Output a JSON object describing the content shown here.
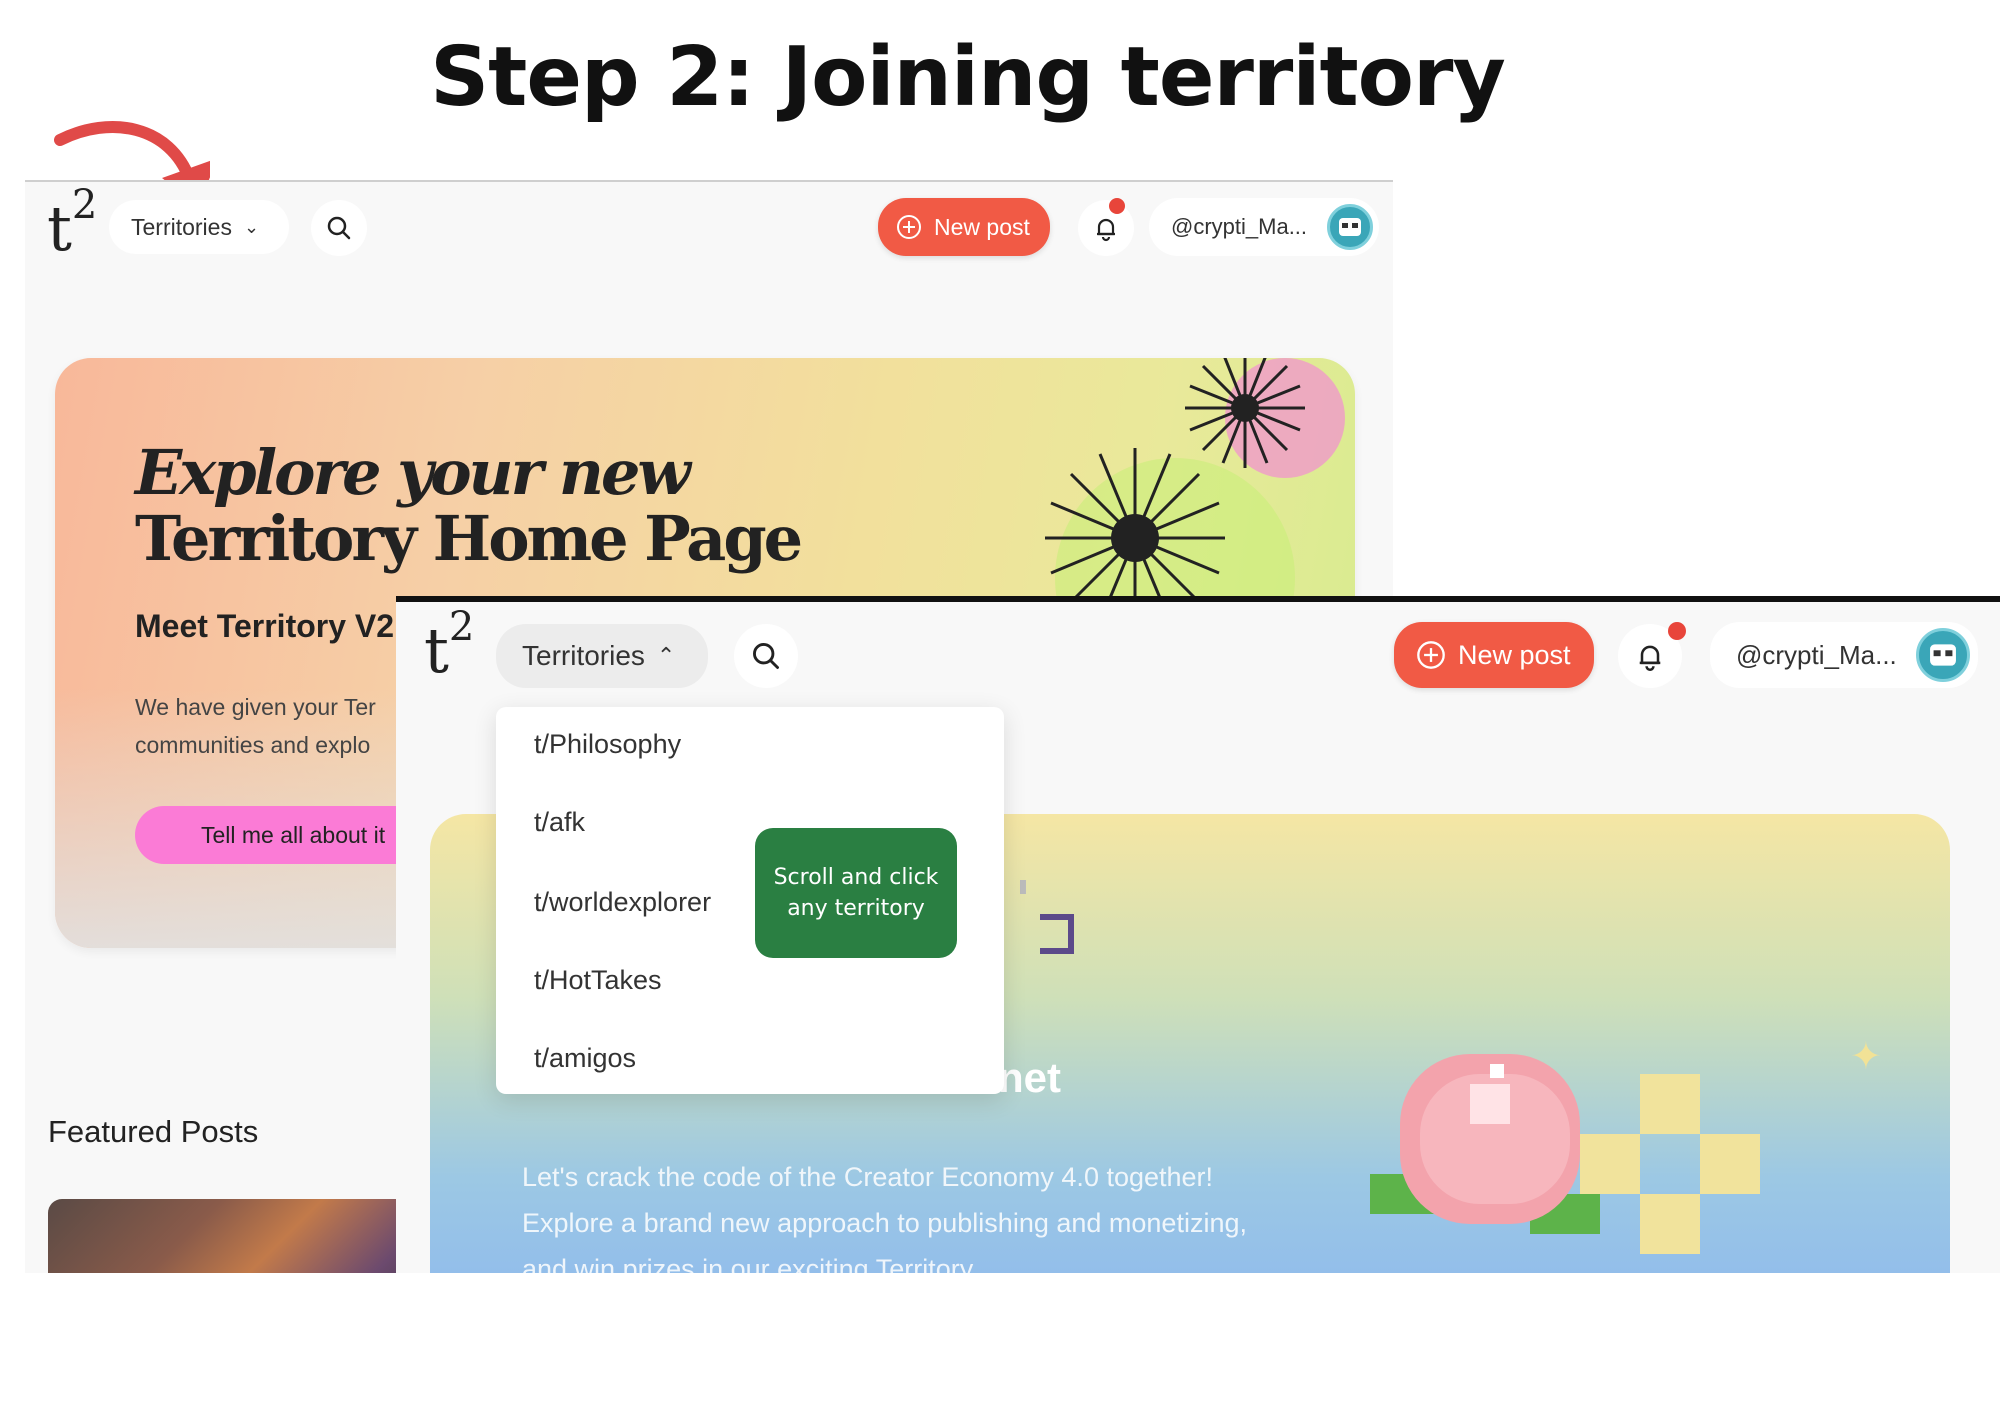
{
  "page": {
    "title": "Step 2: Joining territory"
  },
  "back_screen": {
    "nav": {
      "logo": "t",
      "logo_sup": "2",
      "territories_label": "Territories",
      "new_post_label": "New post",
      "username": "@crypti_Ma..."
    },
    "hero": {
      "heading_line1": "Explore your new",
      "heading_line2": "Territory Home Page",
      "subheading": "Meet Territory V2",
      "body_line1": "We have given your Ter",
      "body_line2": "communities and explo",
      "cta_label": "Tell me all about it"
    },
    "featured_label": "Featured Posts"
  },
  "front_screen": {
    "nav": {
      "logo": "t",
      "logo_sup": "2",
      "territories_label": "Territories",
      "new_post_label": "New post",
      "username": "@crypti_Ma..."
    },
    "dropdown_items": [
      "t/Philosophy",
      "t/afk",
      "t/worldexplorer",
      "t/HotTakes",
      "t/amigos"
    ],
    "hero": {
      "partial_word": "net",
      "body": "Let's crack the code of the Creator Economy 4.0 together! Explore a brand new approach to publishing and monetizing, and win prizes in our exciting Territory"
    }
  },
  "callout": "Scroll and click any territory",
  "colors": {
    "accent_red": "#f15a45",
    "callout_green": "#2a7f42",
    "cta_pink": "#fb7bd6"
  }
}
